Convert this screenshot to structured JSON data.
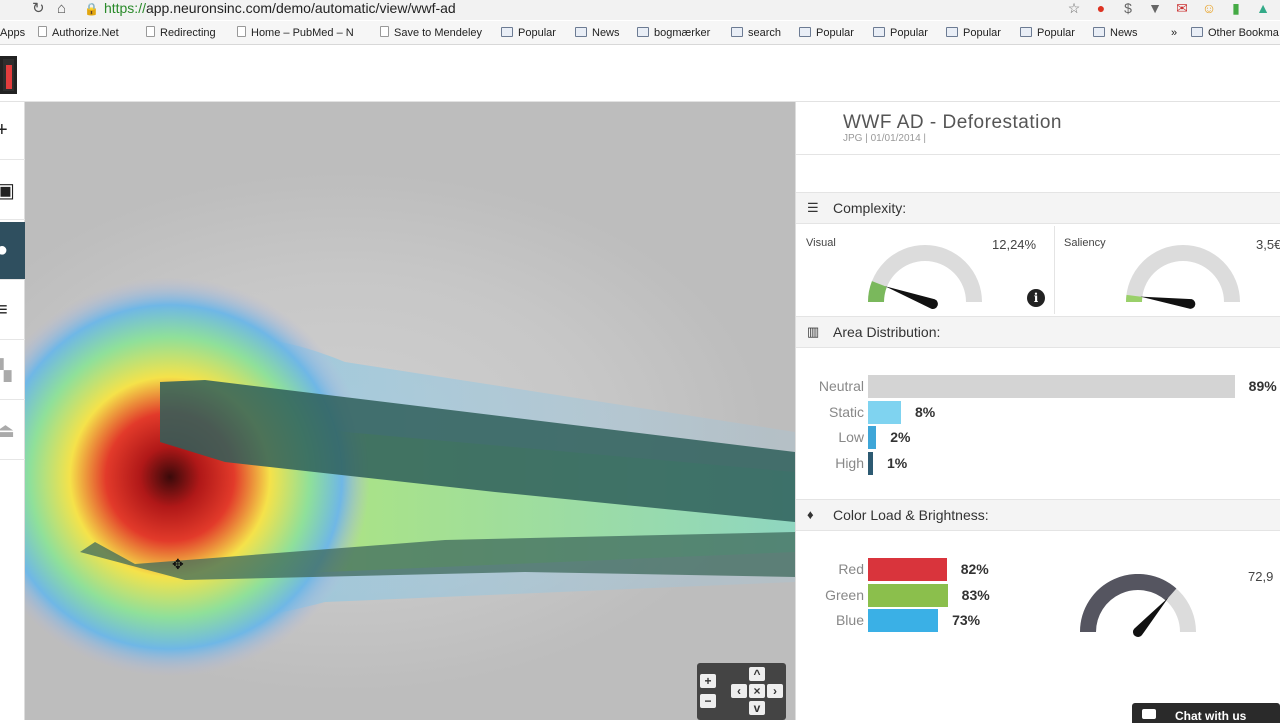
{
  "browser": {
    "url_scheme": "https://",
    "url_rest": "app.neuronsinc.com/demo/automatic/view/wwf-ad",
    "bookmarks": [
      "Apps",
      "Authorize.Net",
      "Redirecting",
      "Home – PubMed – N",
      "Save to Mendeley",
      "Popular",
      "News",
      "bogmærker",
      "search",
      "Popular",
      "Popular",
      "Popular",
      "Popular",
      "News",
      "»",
      "Other Bookma"
    ]
  },
  "panel": {
    "title": "WWF AD - Deforestation",
    "subtitle": "JPG | 01/01/2014 |",
    "complexity": {
      "heading": "Complexity:",
      "visual_label": "Visual",
      "visual_value": "12,24%",
      "visual_fraction": 0.12,
      "saliency_label": "Saliency",
      "saliency_value": "3,5€",
      "saliency_fraction": 0.04
    },
    "area": {
      "heading": "Area Distribution:",
      "rows": [
        {
          "label": "Neutral",
          "value": "89%",
          "fraction": 0.89,
          "color": "#d4d4d4"
        },
        {
          "label": "Static",
          "value": "8%",
          "fraction": 0.08,
          "color": "#7fd3f0"
        },
        {
          "label": "Low",
          "value": "2%",
          "fraction": 0.02,
          "color": "#3ea6d8"
        },
        {
          "label": "High",
          "value": "1%",
          "fraction": 0.01,
          "color": "#2d5a72"
        }
      ]
    },
    "color": {
      "heading": "Color Load & Brightness:",
      "rows": [
        {
          "label": "Red",
          "value": "82%",
          "fraction": 0.82,
          "color": "#d9343c"
        },
        {
          "label": "Green",
          "value": "83%",
          "fraction": 0.83,
          "color": "#8bbf4c"
        },
        {
          "label": "Blue",
          "value": "73%",
          "fraction": 0.73,
          "color": "#3ab0e6"
        }
      ],
      "brightness_value": "72,9",
      "brightness_fraction": 0.73
    }
  },
  "chat_label": "Chat with us",
  "colors": {
    "sidebar_active": "#2f4f5f",
    "gauge_track": "#dcdcdc",
    "gauge_visual": "#7ab85c",
    "gauge_saliency": "#9ad06a",
    "gauge_dark": "#555560"
  }
}
